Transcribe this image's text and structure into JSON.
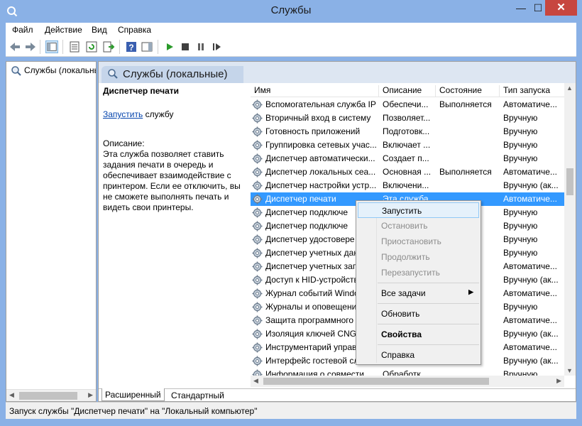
{
  "window": {
    "title": "Службы",
    "minimize": "—",
    "maximize": "☐",
    "close": "✕"
  },
  "menu": [
    "Файл",
    "Действие",
    "Вид",
    "Справка"
  ],
  "tree": {
    "item_label": "Службы (локальные)"
  },
  "banner": {
    "title": "Службы (локальные)"
  },
  "details": {
    "service_name": "Диспетчер печати",
    "start_link": "Запустить",
    "start_suffix": " службу",
    "description_label": "Описание:",
    "description_text": "Эта служба позволяет ставить задания печати в очередь и обеспечивает взаимодействие с принтером. Если ее отключить, вы не сможете выполнять печать и видеть свои принтеры."
  },
  "columns": [
    "Имя",
    "Описание",
    "Состояние",
    "Тип запуска"
  ],
  "rows": [
    {
      "name": "Вспомогательная служба IP",
      "desc": "Обеспечи...",
      "state": "Выполняется",
      "start": "Автоматиче..."
    },
    {
      "name": "Вторичный вход в систему",
      "desc": "Позволяет...",
      "state": "",
      "start": "Вручную"
    },
    {
      "name": "Готовность приложений",
      "desc": "Подготовк...",
      "state": "",
      "start": "Вручную"
    },
    {
      "name": "Группировка сетевых учас...",
      "desc": "Включает ...",
      "state": "",
      "start": "Вручную"
    },
    {
      "name": "Диспетчер автоматически...",
      "desc": "Создает п...",
      "state": "",
      "start": "Вручную"
    },
    {
      "name": "Диспетчер локальных сеа...",
      "desc": "Основная ...",
      "state": "Выполняется",
      "start": "Автоматиче..."
    },
    {
      "name": "Диспетчер настройки устр...",
      "desc": "Включени...",
      "state": "",
      "start": "Вручную (ак..."
    },
    {
      "name": "Диспетчер печати",
      "desc": "Эта служба...",
      "state": "",
      "start": "Автоматиче..."
    },
    {
      "name": "Диспетчер подключе",
      "desc": "",
      "state": "",
      "start": "Вручную"
    },
    {
      "name": "Диспетчер подключе",
      "desc": "",
      "state": "",
      "start": "Вручную"
    },
    {
      "name": "Диспетчер удостовере",
      "desc": "",
      "state": "",
      "start": "Вручную"
    },
    {
      "name": "Диспетчер учетных дан",
      "desc": "",
      "state": "",
      "start": "Вручную"
    },
    {
      "name": "Диспетчер учетных запи",
      "desc": "",
      "state": "ется",
      "start": "Автоматиче..."
    },
    {
      "name": "Доступ к HID-устройств",
      "desc": "",
      "state": "",
      "start": "Вручную (ак..."
    },
    {
      "name": "Журнал событий Windo",
      "desc": "",
      "state": "ется",
      "start": "Автоматиче..."
    },
    {
      "name": "Журналы и оповещени",
      "desc": "",
      "state": "",
      "start": "Вручную"
    },
    {
      "name": "Защита программного",
      "desc": "",
      "state": "",
      "start": "Автоматиче..."
    },
    {
      "name": "Изоляция ключей CNG",
      "desc": "",
      "state": "ется",
      "start": "Вручную (ак..."
    },
    {
      "name": "Инструментарий управ",
      "desc": "",
      "state": "ется",
      "start": "Автоматиче..."
    },
    {
      "name": "Интерфейс гостевой сл",
      "desc": "",
      "state": "",
      "start": "Вручную (ак..."
    },
    {
      "name": "Информация о совмести...",
      "desc": "Обработк...",
      "state": "",
      "start": "Вручную"
    }
  ],
  "tabs": {
    "extended": "Расширенный",
    "standard": "Стандартный"
  },
  "status": "Запуск службы \"Диспетчер печати\" на \"Локальный компьютер\"",
  "context_menu": {
    "start": "Запустить",
    "stop": "Остановить",
    "pause": "Приостановить",
    "resume": "Продолжить",
    "restart": "Перезапустить",
    "all_tasks": "Все задачи",
    "refresh": "Обновить",
    "properties": "Свойства",
    "help": "Справка"
  },
  "colors": {
    "frame": "#8ab1e6",
    "selection": "#3399ff",
    "close_button": "#c7463f"
  }
}
